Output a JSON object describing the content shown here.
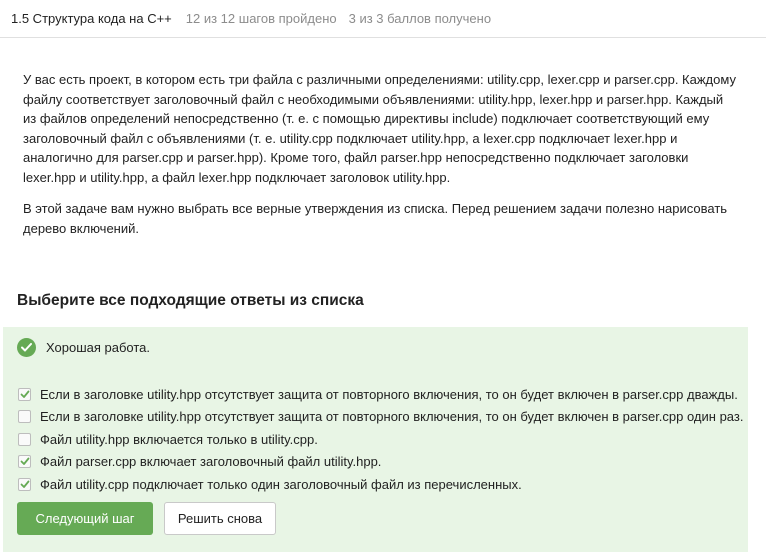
{
  "header": {
    "title": "1.5 Структура кода на C++",
    "steps_progress": "12 из 12 шагов пройдено",
    "score": "3 из 3 баллов  получено"
  },
  "step_text": {
    "paragraph_1": "У вас есть проект, в котором есть три файла с различными определениями: utility.cpp, lexer.cpp и parser.cpp. Каждому файлу соответствует заголовочный файл с необходимыми объявлениями: utility.hpp, lexer.hpp и parser.hpp. Каждый из файлов определений непосредственно (т. е. с помощью директивы include) подключает соответствующий ему заголовочный файл с объявлениями (т. е. utility.cpp подключает utility.hpp, а lexer.cpp подключает lexer.hpp и аналогично для parser.cpp и parser.hpp). Кроме того, файл parser.hpp непосредственно подключает заголовки lexer.hpp и utility.hpp, а файл lexer.hpp подключает заголовок utility.hpp.",
    "paragraph_2": "В этой задаче вам нужно выбрать все верные утверждения из списка. Перед решением задачи полезно нарисовать дерево включений."
  },
  "quiz": {
    "title": "Выберите все подходящие ответы из списка",
    "feedback": "Хорошая работа.",
    "options": [
      {
        "label": "Если в заголовке utility.hpp отсутствует защита от повторного включения, то он будет включен в parser.cpp дважды.",
        "checked": true
      },
      {
        "label": "Если в заголовке utility.hpp отсутствует защита от повторного включения, то он будет включен в parser.cpp один раз.",
        "checked": false
      },
      {
        "label": "Файл utility.hpp включается только в utility.cpp.",
        "checked": false
      },
      {
        "label": "Файл parser.cpp включает заголовочный файл utility.hpp.",
        "checked": true
      },
      {
        "label": "Файл utility.cpp подключает только один заголовочный файл из перечисленных.",
        "checked": true
      }
    ],
    "next_button": "Следующий шаг",
    "retry_button": "Решить снова"
  },
  "colors": {
    "accent": "#66aa55",
    "panel_background": "#e8f5e5",
    "muted_text": "#8c8c8c"
  },
  "icons": {
    "feedback": "check-circle-icon",
    "option_checked": "checkmark-icon"
  }
}
